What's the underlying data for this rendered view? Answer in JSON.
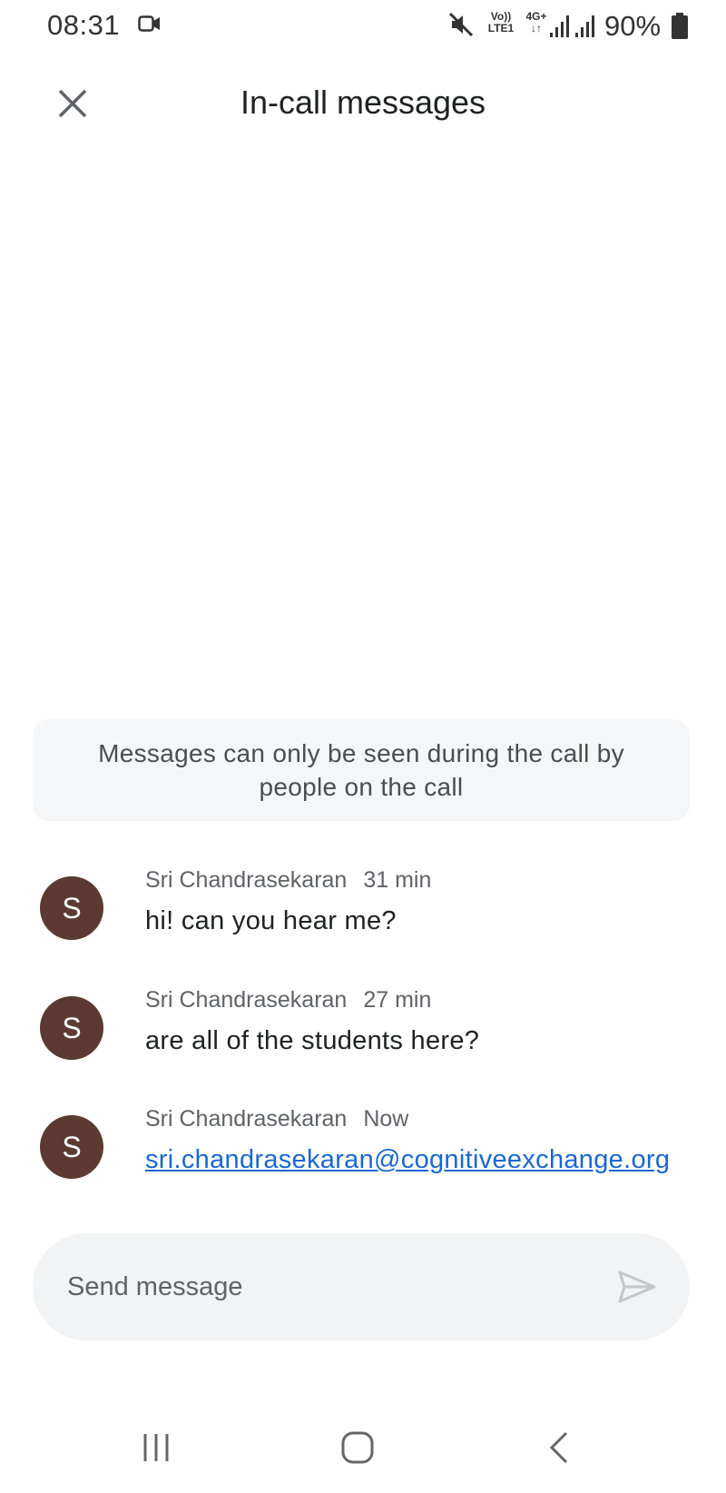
{
  "status_bar": {
    "time": "08:31",
    "volte_line1": "Vo))",
    "volte_line2": "LTE1",
    "network_line1": "4G+",
    "network_line2": "↓↑",
    "battery": "90%",
    "icons": [
      "video-camera-icon",
      "mute-icon",
      "signal-icon",
      "signal-icon",
      "battery-icon"
    ]
  },
  "header": {
    "title": "In-call messages",
    "close_icon": "close-icon"
  },
  "notice": {
    "text": "Messages can only be seen during the call by people on the call"
  },
  "messages": [
    {
      "avatar_letter": "S",
      "sender": "Sri Chandrasekaran",
      "time": "31 min",
      "text": "hi! can you hear me?",
      "is_link": false
    },
    {
      "avatar_letter": "S",
      "sender": "Sri Chandrasekaran",
      "time": "27 min",
      "text": "are all of the students here?",
      "is_link": false
    },
    {
      "avatar_letter": "S",
      "sender": "Sri Chandrasekaran",
      "time": "Now",
      "text": "sri.chandrasekaran@cognitiveexchange.org",
      "is_link": true
    }
  ],
  "composer": {
    "placeholder": "Send message",
    "value": "",
    "send_icon": "send-icon"
  },
  "nav_bar": {
    "icons": [
      "recent-apps-icon",
      "home-icon",
      "back-icon"
    ]
  },
  "colors": {
    "avatar": "#5d3a31",
    "link": "#1a67d2",
    "notice_bg": "#f5f6f8",
    "composer_bg": "#f1f3f4"
  }
}
